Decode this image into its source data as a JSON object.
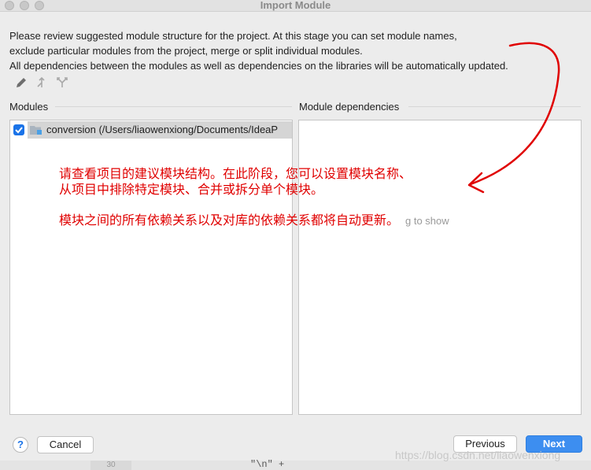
{
  "window": {
    "title": "Import Module"
  },
  "description": [
    "Please review suggested module structure for the project. At this stage you can set module names,",
    "exclude particular modules from the project, merge or split individual modules.",
    "All dependencies between the modules as well as dependencies on the libraries will be automatically updated."
  ],
  "toolbar": {
    "icons": [
      "pencil-icon",
      "merge-icon",
      "split-icon"
    ]
  },
  "modules": {
    "label": "Modules",
    "items": [
      {
        "checked": true,
        "text": "conversion (/Users/liaowenxiong/Documents/IdeaP"
      }
    ]
  },
  "dependencies": {
    "label": "Module dependencies",
    "empty_text": "g to show"
  },
  "annotation": {
    "line1": "请查看项目的建议模块结构。在此阶段，您可以设置模块名称、",
    "line2": "从项目中排除特定模块、合并或拆分单个模块。",
    "line3": "模块之间的所有依赖关系以及对库的依赖关系都将自动更新。",
    "color": "#e00000"
  },
  "buttons": {
    "help": "?",
    "cancel": "Cancel",
    "previous": "Previous",
    "next": "Next"
  },
  "watermark": "https://blog.csdn.net/liaowenxiong",
  "background_strip": {
    "line_number": "30",
    "code": "\"\\n\" +"
  },
  "colors": {
    "accent": "#3d8ef0",
    "checkbox": "#1a73e8"
  }
}
